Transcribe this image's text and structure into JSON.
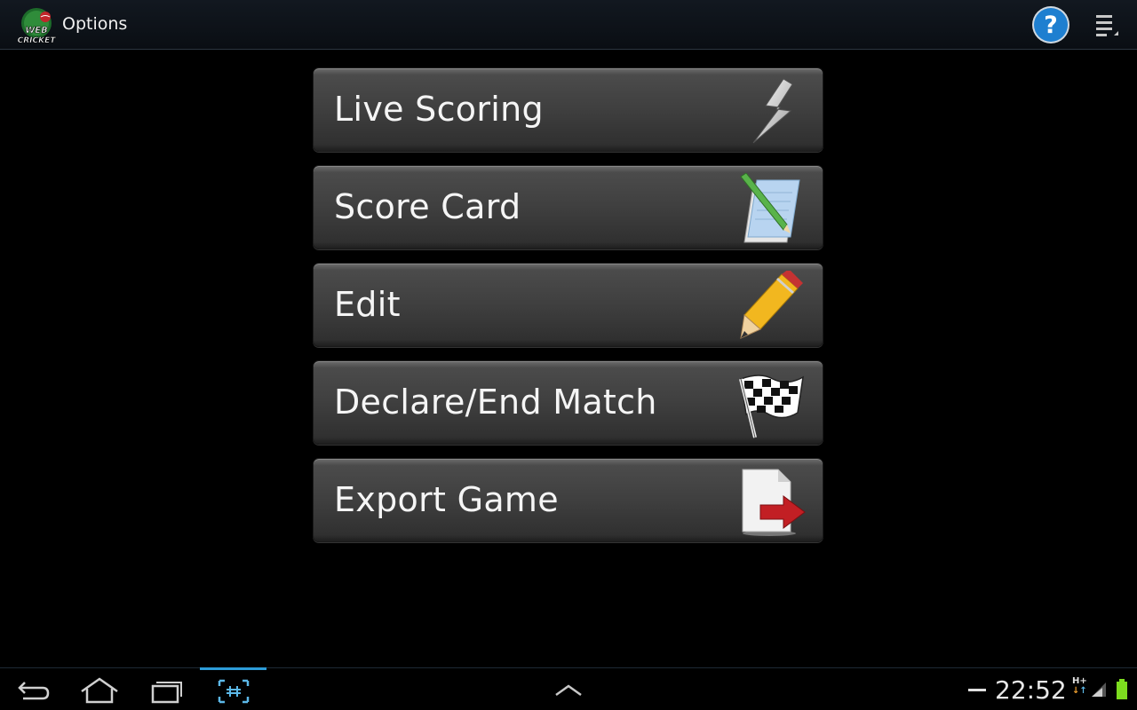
{
  "action_bar": {
    "title": "Options",
    "logo_text_top": "WEB",
    "logo_text_bottom": "CRICKET"
  },
  "menu": {
    "items": [
      {
        "label": "Live Scoring",
        "icon": "lightning-icon"
      },
      {
        "label": "Score Card",
        "icon": "notepad-pencil-icon"
      },
      {
        "label": "Edit",
        "icon": "pencil-icon"
      },
      {
        "label": "Declare/End Match",
        "icon": "checkered-flag-icon"
      },
      {
        "label": "Export Game",
        "icon": "export-document-icon"
      }
    ]
  },
  "status_bar": {
    "time": "22:52",
    "network": "H+"
  },
  "colors": {
    "accent": "#2d9cd8",
    "help": "#1e7fd0",
    "battery": "#7ddc1f"
  }
}
